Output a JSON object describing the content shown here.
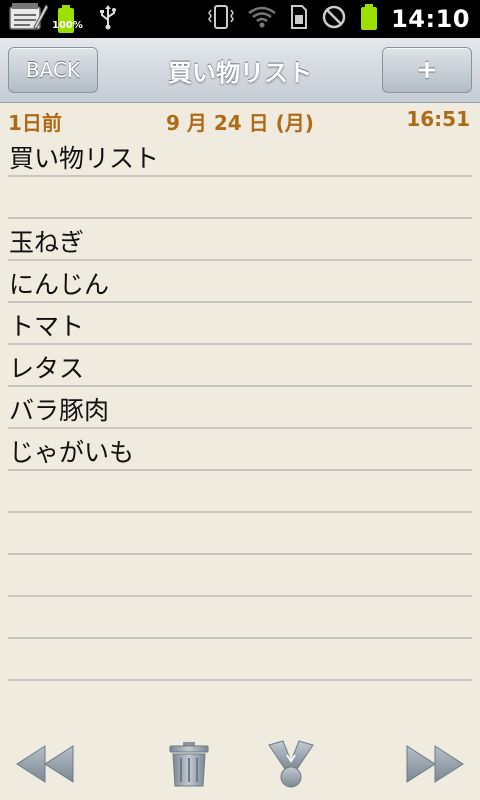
{
  "status_bar": {
    "battery_percent": "100%",
    "time": "14:10",
    "icons": [
      "notepad-app-icon",
      "battery-icon",
      "usb-icon",
      "vibrate-icon",
      "wifi-icon",
      "sim-icon",
      "no-signal-icon",
      "battery-icon"
    ]
  },
  "header": {
    "back_label": "BACK",
    "title": "買い物リスト",
    "add_label": "+"
  },
  "date_row": {
    "relative": "1日前",
    "date": "9 月 24 日 (月)",
    "time": "16:51"
  },
  "note": {
    "lines": [
      "買い物リスト",
      "",
      "玉ねぎ",
      "にんじん",
      "トマト",
      "レタス",
      "バラ豚肉",
      "じゃがいも",
      "",
      "",
      "",
      "",
      ""
    ]
  },
  "toolbar": {
    "icons": [
      "rewind-icon",
      "trash-icon",
      "share-icon",
      "fast-forward-icon"
    ]
  },
  "colors": {
    "background": "#efebde",
    "date_text": "#b06a16",
    "title_bar": "#c5ccd4"
  }
}
